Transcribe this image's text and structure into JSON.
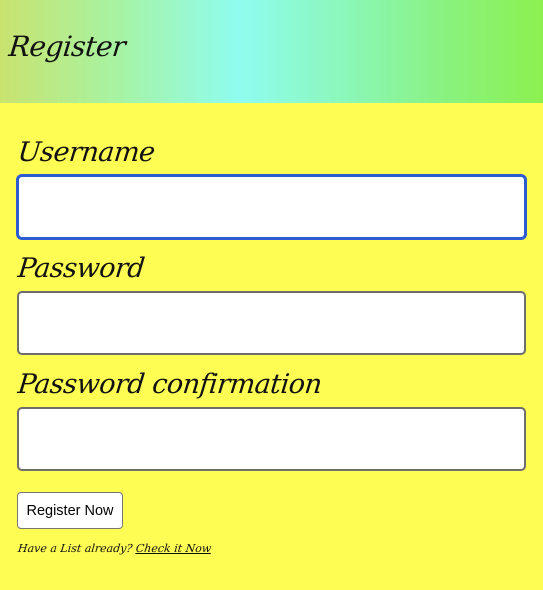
{
  "header": {
    "title": "Register"
  },
  "form": {
    "username_label": "Username",
    "password_label": "Password",
    "password_confirmation_label": "Password confirmation",
    "username_value": "",
    "password_value": "",
    "password_confirmation_value": "",
    "submit_label": "Register Now"
  },
  "footer": {
    "prompt": "Have a List already?",
    "link_label": "Check it Now"
  },
  "colors": {
    "page_background": "#fdfd54",
    "focus_border": "#2d5bd1"
  }
}
